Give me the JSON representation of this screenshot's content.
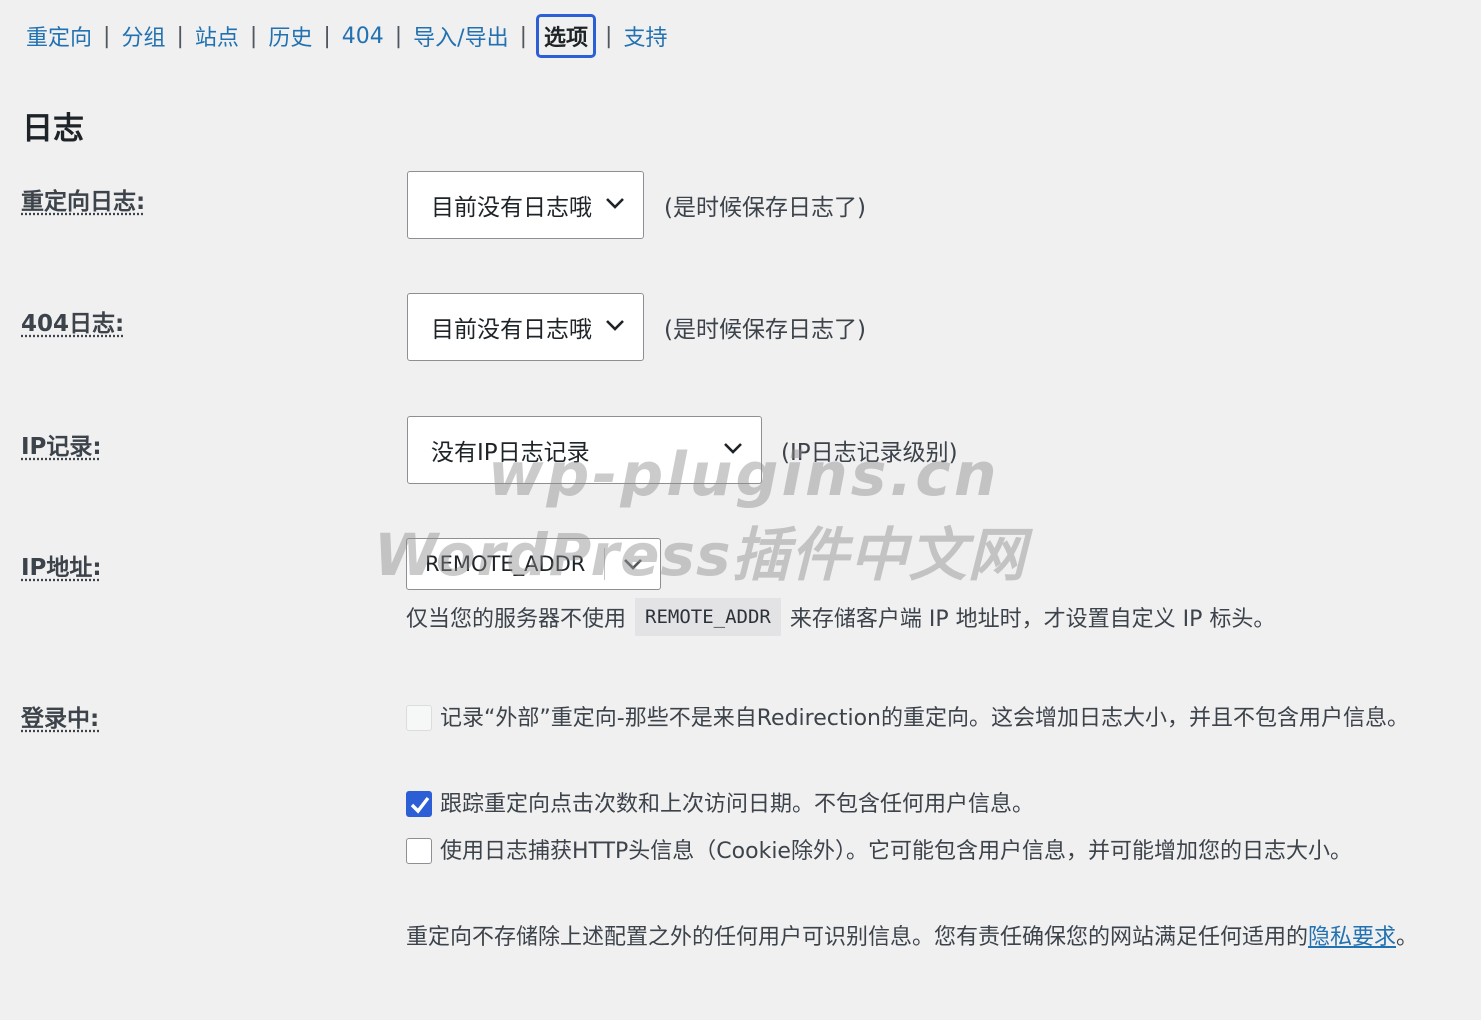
{
  "nav": {
    "items": [
      {
        "label": "重定向",
        "current": false
      },
      {
        "label": "分组",
        "current": false
      },
      {
        "label": "站点",
        "current": false
      },
      {
        "label": "历史",
        "current": false
      },
      {
        "label": "404",
        "current": false
      },
      {
        "label": "导入/导出",
        "current": false
      },
      {
        "label": "选项",
        "current": true
      },
      {
        "label": "支持",
        "current": false
      }
    ],
    "separator": "|"
  },
  "section_title": "日志",
  "settings": {
    "redirect_log": {
      "label": "重定向日志:",
      "selected": "目前没有日志哦",
      "hint": "(是时候保存日志了)"
    },
    "log_404": {
      "label": "404日志:",
      "selected": "目前没有日志哦",
      "hint": "(是时候保存日志了)"
    },
    "ip_logging": {
      "label": "IP记录:",
      "selected": "没有IP日志记录",
      "hint": "(IP日志记录级别)"
    },
    "ip_address": {
      "label": "IP地址:",
      "selected": "REMOTE_ADDR",
      "desc_before": "仅当您的服务器不使用",
      "desc_code": "REMOTE_ADDR",
      "desc_after": "来存储客户端 IP 地址时，才设置自定义 IP 标头。"
    },
    "logging": {
      "label": "登录中:",
      "options": [
        {
          "text": "记录“外部”重定向-那些不是来自Redirection的重定向。这会增加日志大小，并且不包含用户信息。",
          "checked": false,
          "disabled": true
        },
        {
          "text": "跟踪重定向点击次数和上次访问日期。不包含任何用户信息。",
          "checked": true,
          "disabled": false
        },
        {
          "text": "使用日志捕获HTTP头信息（Cookie除外）。它可能包含用户信息，并可能增加您的日志大小。",
          "checked": false,
          "disabled": false
        }
      ]
    }
  },
  "privacy": {
    "text": "重定向不存储除上述配置之外的任何用户可识别信息。您有责任确保您的网站满足任何适用的",
    "link": "隐私要求",
    "end": "。"
  },
  "watermark": {
    "line1": "wp-plugins.cn",
    "line2": "WordPress插件中文网"
  },
  "colors": {
    "link": "#2271b1",
    "accent": "#2c5fd6",
    "background": "#f0f0f1"
  }
}
